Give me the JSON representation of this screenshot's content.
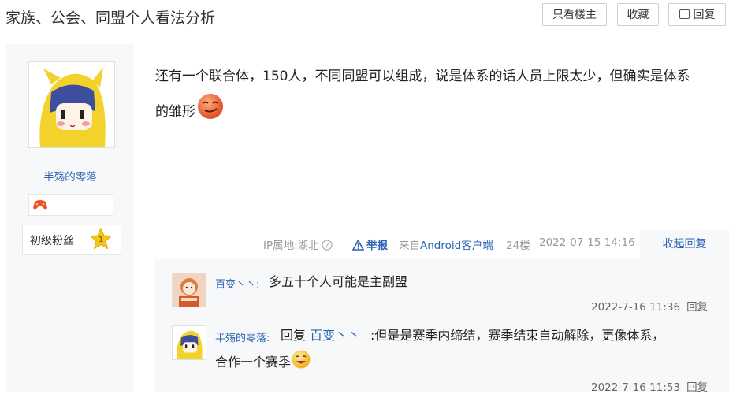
{
  "header": {
    "title": "家族、公会、同盟个人看法分析",
    "btn_only_lz": "只看楼主",
    "btn_favorite": "收藏",
    "btn_reply": "回复"
  },
  "author": {
    "name": "半殇的零落",
    "level_title": "初级粉丝",
    "level_num": "1"
  },
  "post": {
    "text_line1": "还有一个联合体，150人，不同同盟可以组成，说是体系的话人员上限太少，但确实是体系",
    "text_line2": "的雏形"
  },
  "tail": {
    "ip": "IP属地:湖北",
    "report": "举报",
    "from_prefix": "来自",
    "from_client": "Android客户端",
    "floor": "24楼",
    "time": "2022-07-15 14:16",
    "collapse": "收起回复"
  },
  "replies": [
    {
      "name": "百变丶丶:",
      "text": "多五十个人可能是主副盟",
      "time": "2022-7-16 11:36",
      "reply_label": "回复"
    },
    {
      "name": "半殇的零落:",
      "reply_word": "回复",
      "reply_to": "百变丶丶",
      "text_line1": ":但是是赛季内缔结，赛季结束自动解除，更像体系，",
      "text_line2": "合作一个赛季",
      "time": "2022-7-16 11:53",
      "reply_label": "回复"
    }
  ],
  "colors": {
    "link": "#2d64b3",
    "panel_bg": "#f7f8fa",
    "report_triangle": "#2d64b3",
    "level_star": "#f5c518"
  },
  "icons": {
    "ip_help": "question-circle-icon",
    "report": "warning-triangle-icon",
    "reply": "comment-icon",
    "game_badge": "gamepad-icon",
    "level_star": "star-icon",
    "emoji_smirk": "smirk-face-icon",
    "emoji_grin": "grin-face-icon"
  }
}
